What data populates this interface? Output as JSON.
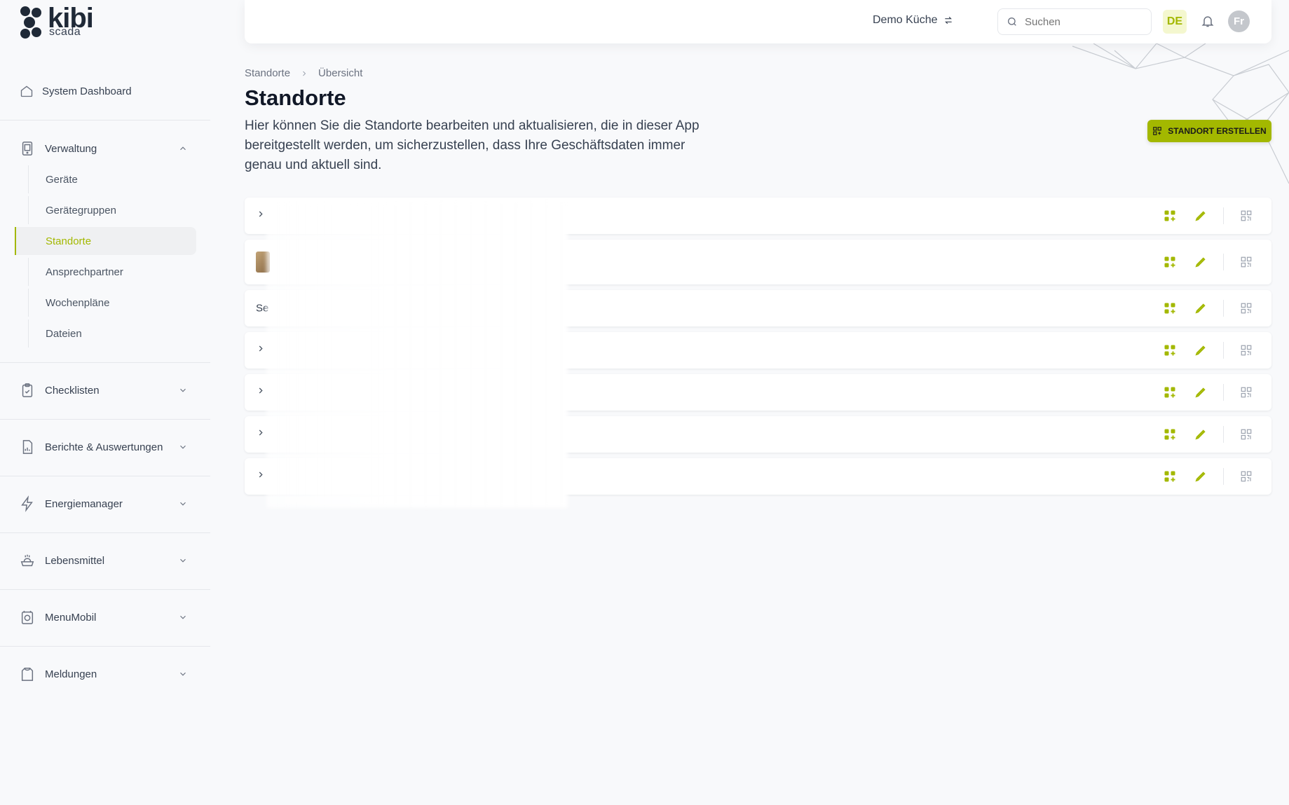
{
  "brand": {
    "name": "kibi",
    "sub": "scada"
  },
  "nav": {
    "dashboard": "System Dashboard",
    "groups": [
      {
        "label": "Verwaltung",
        "open": true,
        "icon": "tablet-icon",
        "items": [
          "Geräte",
          "Gerätegruppen",
          "Standorte",
          "Ansprechpartner",
          "Wochenpläne",
          "Dateien"
        ],
        "active": "Standorte"
      },
      {
        "label": "Checklisten",
        "icon": "clipboard-check-icon"
      },
      {
        "label": "Berichte & Auswertungen",
        "icon": "report-icon"
      },
      {
        "label": "Energiemanager",
        "icon": "lightning-icon"
      },
      {
        "label": "Lebensmittel",
        "icon": "food-icon"
      },
      {
        "label": "MenuMobil",
        "icon": "menu-mobile-icon"
      },
      {
        "label": "Meldungen",
        "icon": "shirt-icon"
      }
    ]
  },
  "topbar": {
    "site": "Demo Küche",
    "search_placeholder": "Suchen",
    "lang": "DE",
    "avatar_initials": "Fr"
  },
  "breadcrumb": [
    "Standorte",
    "Übersicht"
  ],
  "page": {
    "title": "Standorte",
    "description": "Hier können Sie die Standorte bearbeiten und aktualisieren, die in dieser App bereitgestellt werden, um sicherzustellen, dass Ihre Geschäftsdaten immer genau und aktuell sind.",
    "create_button": "STANDORT ERSTELLEN"
  },
  "rows": [
    {
      "type": "expand",
      "label": ""
    },
    {
      "type": "thumb",
      "label": ""
    },
    {
      "type": "text",
      "label": "Se"
    },
    {
      "type": "expand",
      "label": ""
    },
    {
      "type": "expand",
      "label": ""
    },
    {
      "type": "expand",
      "label": ""
    },
    {
      "type": "expand",
      "label": ""
    }
  ],
  "colors": {
    "accent": "#a3b800",
    "accent_light": "#f4f7cf",
    "text": "#111827",
    "muted": "#6b7280"
  }
}
